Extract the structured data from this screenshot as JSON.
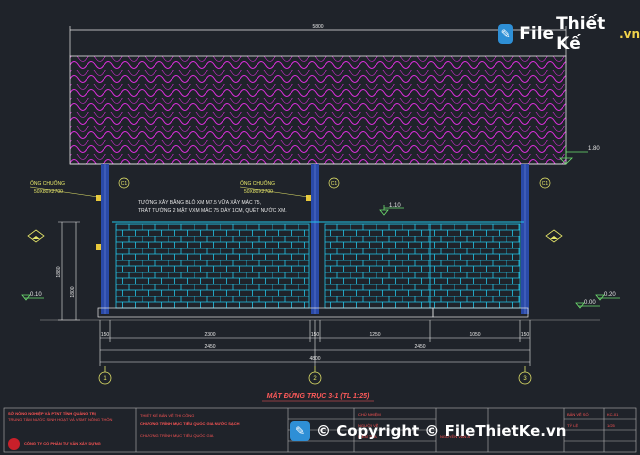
{
  "drawing": {
    "title": "MẶT ĐỨNG TRỤC 3-1 (TL 1:25)",
    "dims": {
      "overall_top": "5800",
      "span_bottom_1": "4800",
      "span_left_total": "2450",
      "span_right_total": "2450",
      "seg_left": "2300",
      "seg_mid_a": "150",
      "seg_mid_b": "1250",
      "seg_right": "1050",
      "post_left": "150",
      "post_right": "150",
      "height_total": "1880",
      "height_part": "1800",
      "ground_dim": "300"
    },
    "levels": {
      "roof": "1.80",
      "wall_top": "1.10",
      "left_base": "0.10",
      "right_a": "0.20",
      "right_b": "0.00"
    },
    "labels": {
      "column_tag": "C1",
      "pipe_left_title": "ỐNG CHUỐNG",
      "pipe_left_size": "50X80X2700",
      "pipe_right_title": "ỐNG CHUỐNG",
      "pipe_right_size": "50X80X2700",
      "note_line1": "TƯỜNG XÂY BẰNG BLÔ XM M7.5 VỮA XÂY MÁC 75,",
      "note_line2": "TRÁT TƯỜNG 2 MẶT VXM MÁC 75 DÀY 1CM, QUÉT NƯỚC XM."
    },
    "axes": [
      "1",
      "2",
      "3"
    ]
  },
  "title_block": {
    "org": "SỞ NÔNG NGHIỆP VÀ PTNT TỈNH QUẢNG TRỊ",
    "org2": "TRUNG TÂM NƯỚC SINH HOẠT VÀ VSMT NÔNG THÔN",
    "company": "CÔNG TY CỔ PHẦN TƯ VẤN XÂY DỰNG",
    "project_hdr": "THIẾT KẾ BẢN VẼ THI CÔNG",
    "project": "CHƯƠNG TRÌNH MỤC TIÊU QUỐC GIA NƯỚC SẠCH",
    "sub": "CHƯƠNG TRÌNH MỤC TIÊU QUỐC GIA",
    "c1": "CHỦ NHIỆM",
    "c2": "NGƯỜI VẼ",
    "c3": "KIỂM TRA",
    "c4": "NGUYỄN VĂN A",
    "c5": "BẢN VẼ SỐ",
    "c6": "KC-01",
    "c7": "TỶ LỆ",
    "c8": "1/25"
  },
  "watermark": {
    "top_text_a": "File",
    "top_text_b": "Thiết Kế",
    "top_text_c": ".vn",
    "bottom_text": "© Copyright © FileThietKe.vn"
  },
  "colors": {
    "bg": "#1f232a",
    "roof": "#d82ed8",
    "brick": "#22c4e8",
    "dim": "#e8e8e8",
    "level": "#6fe06f",
    "label": "#e8e86a",
    "axis": "#e8e86a",
    "column": "#2a4aa8",
    "tb": "#ff5555"
  }
}
